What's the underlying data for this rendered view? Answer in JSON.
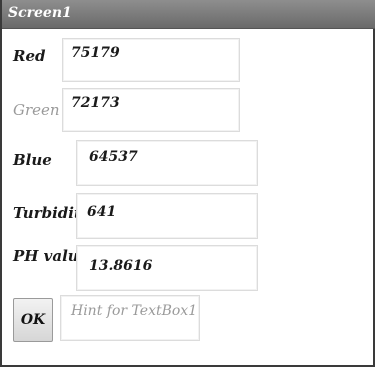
{
  "window": {
    "title": "Screen1"
  },
  "form": {
    "red_label": "Red",
    "red_value": "75179",
    "green_label": "Green",
    "green_value": "72173",
    "blue_label": "Blue",
    "blue_value": "64537",
    "turbidity_label": "Turbidity",
    "turbidity_value": "641",
    "ph_label": "PH value",
    "ph_value": "13.8616"
  },
  "ok_button": {
    "label": "OK"
  },
  "textbox1": {
    "placeholder": "Hint for TextBox1"
  }
}
